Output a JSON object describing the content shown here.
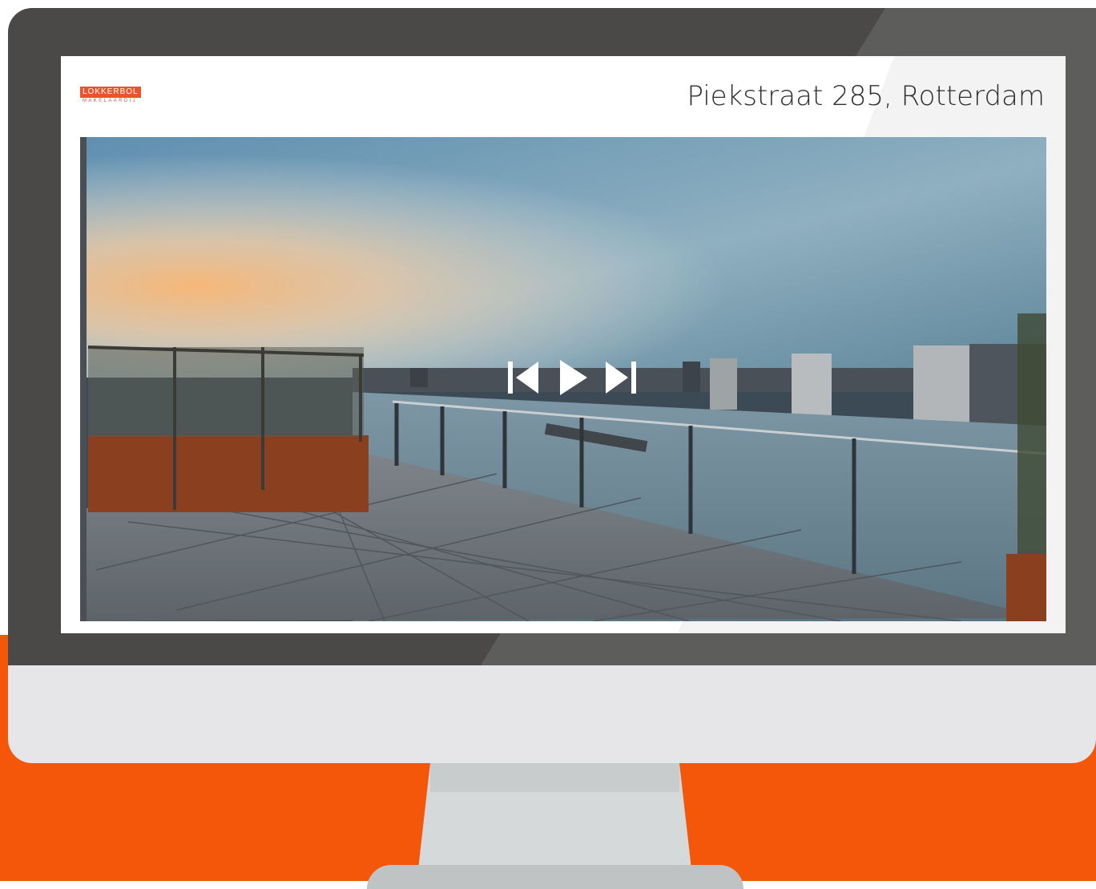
{
  "brand": {
    "name": "LOKKERBOL",
    "tagline": "MAKELAARDIJ",
    "color": "#e8552a"
  },
  "listing": {
    "address": "Piekstraat 285, Rotterdam"
  },
  "slideshow": {
    "controls": [
      {
        "name": "previous",
        "icon": "skip-previous-icon"
      },
      {
        "name": "play",
        "icon": "play-icon"
      },
      {
        "name": "next",
        "icon": "skip-next-icon"
      }
    ]
  },
  "colors": {
    "accent_orange": "#f4560a",
    "bezel": "#4a4947",
    "chin": "#e6e6e9",
    "stand": "#d6d9d9"
  }
}
